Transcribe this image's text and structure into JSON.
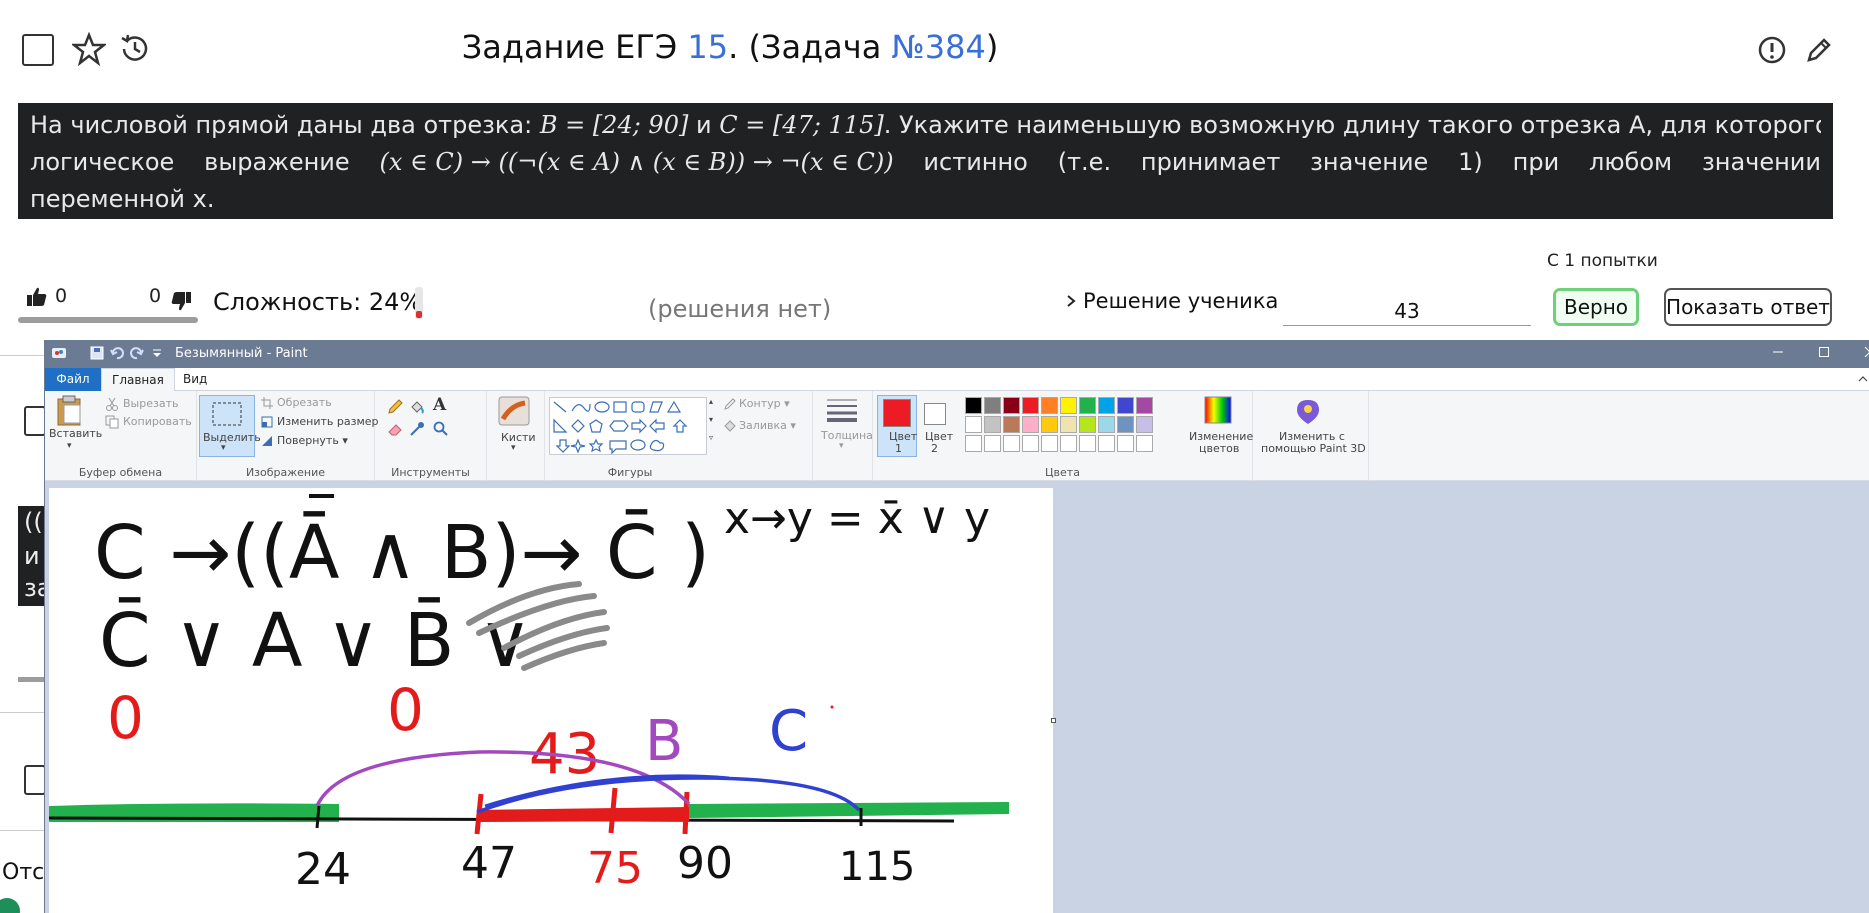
{
  "task": {
    "title_prefix": "Задание ЕГЭ ",
    "title_num": "15",
    "title_mid": ". (Задача ",
    "title_task": "№384",
    "title_suffix": ")",
    "line1_a": "На числовой прямой даны два отрезка: ",
    "line1_b": "B = [24; 90]",
    "line1_c": " и ",
    "line1_d": "C = [47; 115]",
    "line1_e": ". Укажите наименьшую возможную длину такого отрезка А, для которого",
    "line2_a": "логическое",
    "line2_b": "выражение",
    "line2_c": "(x ∈ C) → ((¬(x ∈ A) ∧ (x ∈ B)) → ¬(x ∈ C))",
    "line2_d": "истинно",
    "line2_e": "(т.е.",
    "line2_f": "принимает",
    "line2_g": "значение",
    "line2_h": "1)",
    "line2_i": "при",
    "line2_j": "любом",
    "line2_k": "значении",
    "line3": "переменной х."
  },
  "stats": {
    "attempts": "С 1 попытки",
    "likes": "0",
    "dislikes": "0",
    "difficulty": "Сложность: 24%",
    "difficulty_fraction": 0.24,
    "no_solutions": "(решения нет)",
    "student_solution": "Решение ученика",
    "answer_value": "43",
    "correct_label": "Верно",
    "show_answer_label": "Показать ответ"
  },
  "peek": {
    "dark_chars": [
      "((",
      "и",
      "за"
    ],
    "bottom_text": "Отс"
  },
  "paint": {
    "title": "Безымянный - Paint",
    "menu": {
      "file": "Файл",
      "home": "Главная",
      "view": "Вид"
    },
    "clipboard": {
      "paste": "Вставить",
      "cut": "Вырезать",
      "copy": "Копировать",
      "label": "Буфер обмена"
    },
    "image": {
      "select": "Выделить",
      "crop": "Обрезать",
      "resize": "Изменить размер",
      "rotate": "Повернуть",
      "label": "Изображение"
    },
    "tools": {
      "label": "Инструменты",
      "text_tool": "A"
    },
    "brushes": "Кисти",
    "shapes": {
      "outline": "Контур",
      "fill": "Заливка",
      "label": "Фигуры"
    },
    "thickness": "Толщина",
    "color1": [
      "Цвет",
      "1"
    ],
    "color2": [
      "Цвет",
      "2"
    ],
    "edit_colors": [
      "Изменение",
      "цветов"
    ],
    "paint3d": [
      "Изменить с",
      "помощью Paint 3D"
    ],
    "colors_label": "Цвета",
    "palette_row1": [
      "#000000",
      "#7f7f7f",
      "#880015",
      "#ed1c24",
      "#ff7f27",
      "#fff200",
      "#22b14c",
      "#00a2e8",
      "#3f48cc",
      "#a349a4"
    ],
    "palette_row2": [
      "#ffffff",
      "#c3c3c3",
      "#b97a57",
      "#ffaec9",
      "#ffc90e",
      "#efe4b0",
      "#b5e61d",
      "#99d9ea",
      "#7092be",
      "#c8bfe7"
    ],
    "active_color": "#ed1c24"
  },
  "drawing": {
    "expr_top": "C →((Ā ∧ B)→ C̄ )",
    "impl_rule": "x→y = x̄ ∨ y",
    "expr_bottom": "C̄ ∨ A ∨ B̄ ∨",
    "zero_left": "0",
    "zero_right": "0",
    "label_43": "43",
    "label_B": "B",
    "label_C": "C",
    "tick_24": "24",
    "tick_47": "47",
    "tick_75": "75",
    "tick_90": "90",
    "tick_115": "115"
  }
}
